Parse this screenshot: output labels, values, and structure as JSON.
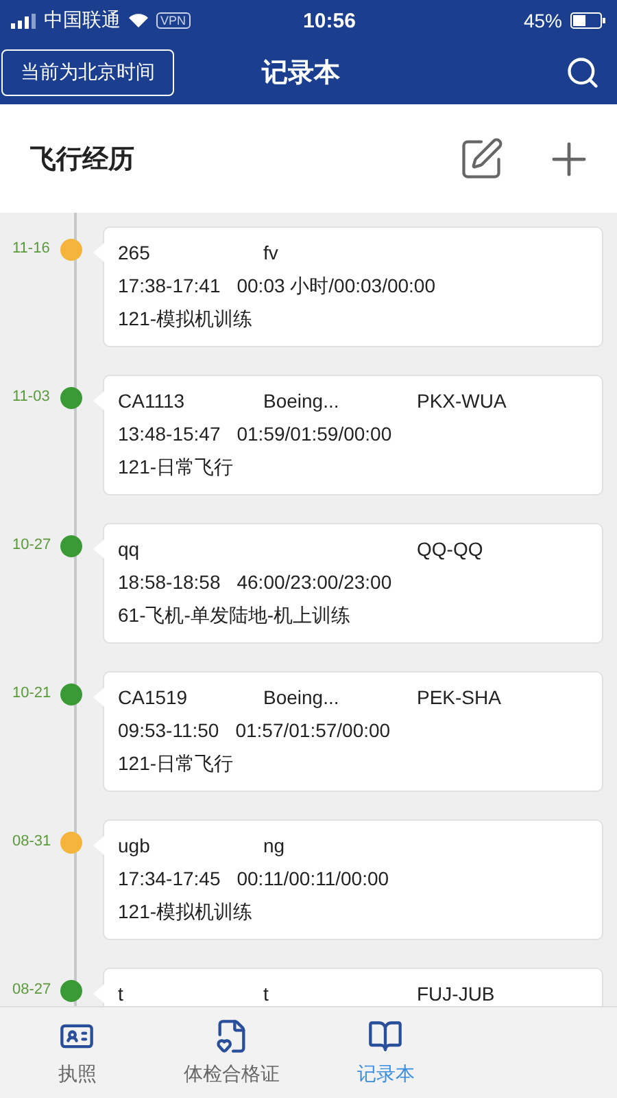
{
  "status_bar": {
    "carrier": "中国联通",
    "vpn": "VPN",
    "time": "10:56",
    "battery": "45%"
  },
  "header": {
    "time_zone_button": "当前为北京时间",
    "title": "记录本"
  },
  "section": {
    "title": "飞行经历"
  },
  "entries": [
    {
      "date": "11-16",
      "color": "#f5b43c",
      "flight": "265",
      "aircraft": "fv",
      "times": "17:38-17:41",
      "durations": "00:03 小时/00:03/00:00",
      "type": "121-模拟机训练"
    },
    {
      "date": "11-03",
      "color": "#3a9a35",
      "flight": "CA1113",
      "aircraft": "Boeing...",
      "route": "PKX-WUA",
      "times": "13:48-15:47",
      "durations": "01:59/01:59/00:00",
      "type": "121-日常飞行"
    },
    {
      "date": "10-27",
      "color": "#3a9a35",
      "flight": "qq",
      "route": "QQ-QQ",
      "times": "18:58-18:58",
      "durations": "46:00/23:00/23:00",
      "type": "61-飞机-单发陆地-机上训练"
    },
    {
      "date": "10-21",
      "color": "#3a9a35",
      "flight": "CA1519",
      "aircraft": "Boeing...",
      "route": "PEK-SHA",
      "times": "09:53-11:50",
      "durations": "01:57/01:57/00:00",
      "type": "121-日常飞行"
    },
    {
      "date": "08-31",
      "color": "#f5b43c",
      "flight": "ugb",
      "aircraft": "ng",
      "times": "17:34-17:45",
      "durations": "00:11/00:11/00:00",
      "type": "121-模拟机训练"
    },
    {
      "date": "08-27",
      "color": "#3a9a35",
      "flight": "t",
      "aircraft": "t",
      "route": "FUJ-JUB"
    }
  ],
  "tabs": [
    {
      "kind": "license",
      "label": "执照",
      "selected": false
    },
    {
      "kind": "medical",
      "label": "体检合格证",
      "selected": false
    },
    {
      "kind": "logbook",
      "label": "记录本",
      "selected": true
    }
  ]
}
